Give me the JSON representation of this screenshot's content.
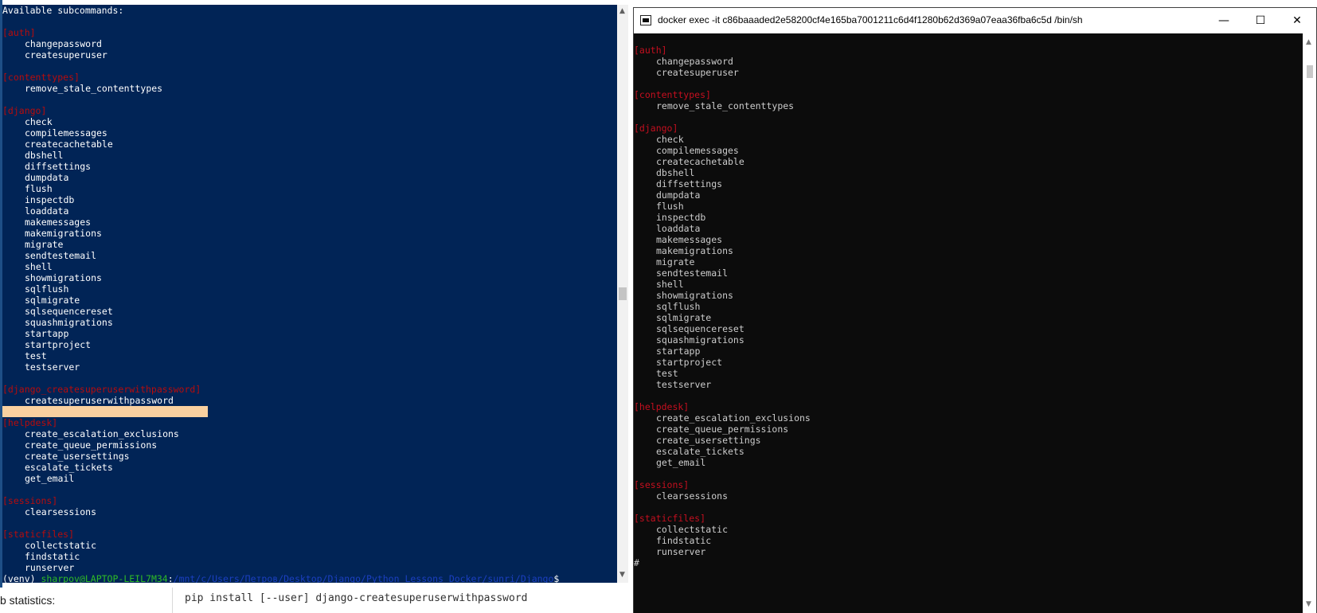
{
  "left_terminal": {
    "lines": [
      {
        "text": "Available subcommands:",
        "kind": "plain"
      },
      {
        "text": "",
        "kind": "plain"
      },
      {
        "text": "[auth]",
        "kind": "head"
      },
      {
        "text": "changepassword",
        "kind": "sub"
      },
      {
        "text": "createsuperuser",
        "kind": "sub"
      },
      {
        "text": "",
        "kind": "plain"
      },
      {
        "text": "[contenttypes]",
        "kind": "head"
      },
      {
        "text": "remove_stale_contenttypes",
        "kind": "sub"
      },
      {
        "text": "",
        "kind": "plain"
      },
      {
        "text": "[django]",
        "kind": "head"
      },
      {
        "text": "check",
        "kind": "sub"
      },
      {
        "text": "compilemessages",
        "kind": "sub"
      },
      {
        "text": "createcachetable",
        "kind": "sub"
      },
      {
        "text": "dbshell",
        "kind": "sub"
      },
      {
        "text": "diffsettings",
        "kind": "sub"
      },
      {
        "text": "dumpdata",
        "kind": "sub"
      },
      {
        "text": "flush",
        "kind": "sub"
      },
      {
        "text": "inspectdb",
        "kind": "sub"
      },
      {
        "text": "loaddata",
        "kind": "sub"
      },
      {
        "text": "makemessages",
        "kind": "sub"
      },
      {
        "text": "makemigrations",
        "kind": "sub"
      },
      {
        "text": "migrate",
        "kind": "sub"
      },
      {
        "text": "sendtestemail",
        "kind": "sub"
      },
      {
        "text": "shell",
        "kind": "sub"
      },
      {
        "text": "showmigrations",
        "kind": "sub"
      },
      {
        "text": "sqlflush",
        "kind": "sub"
      },
      {
        "text": "sqlmigrate",
        "kind": "sub"
      },
      {
        "text": "sqlsequencereset",
        "kind": "sub"
      },
      {
        "text": "squashmigrations",
        "kind": "sub"
      },
      {
        "text": "startapp",
        "kind": "sub"
      },
      {
        "text": "startproject",
        "kind": "sub"
      },
      {
        "text": "test",
        "kind": "sub"
      },
      {
        "text": "testserver",
        "kind": "sub"
      },
      {
        "text": "",
        "kind": "plain"
      },
      {
        "text": "[django_createsuperuserwithpassword]",
        "kind": "head"
      },
      {
        "text": "createsuperuserwithpassword",
        "kind": "sub"
      },
      {
        "text": "",
        "kind": "sel"
      },
      {
        "text": "[helpdesk]",
        "kind": "head"
      },
      {
        "text": "create_escalation_exclusions",
        "kind": "sub"
      },
      {
        "text": "create_queue_permissions",
        "kind": "sub"
      },
      {
        "text": "create_usersettings",
        "kind": "sub"
      },
      {
        "text": "escalate_tickets",
        "kind": "sub"
      },
      {
        "text": "get_email",
        "kind": "sub"
      },
      {
        "text": "",
        "kind": "plain"
      },
      {
        "text": "[sessions]",
        "kind": "head"
      },
      {
        "text": "clearsessions",
        "kind": "sub"
      },
      {
        "text": "",
        "kind": "plain"
      },
      {
        "text": "[staticfiles]",
        "kind": "head"
      },
      {
        "text": "collectstatic",
        "kind": "sub"
      },
      {
        "text": "findstatic",
        "kind": "sub"
      },
      {
        "text": "runserver",
        "kind": "sub"
      }
    ],
    "prompt": {
      "venv": "(venv) ",
      "user": "sharpov@LAPTOP-LEIL7M34",
      "sep": ":",
      "path": "/mnt/c/Users/Петров/Desktop/Django/Python_Lessons_Docker/sunri/Django",
      "end": "$"
    }
  },
  "bottom_strip": {
    "left_label": "b statistics:",
    "code": "pip install [--user] django-createsuperuserwithpassword"
  },
  "docker_window": {
    "title": "docker  exec -it c86baaaded2e58200cf4e165ba7001211c6d4f1280b62d369a07eaa36fba6c5d /bin/sh",
    "buttons": {
      "minimize": "—",
      "maximize": "☐",
      "close": "✕"
    },
    "lines": [
      {
        "text": "[auth]",
        "kind": "head"
      },
      {
        "text": "changepassword",
        "kind": "sub"
      },
      {
        "text": "createsuperuser",
        "kind": "sub"
      },
      {
        "text": "",
        "kind": "plain"
      },
      {
        "text": "[contenttypes]",
        "kind": "head"
      },
      {
        "text": "remove_stale_contenttypes",
        "kind": "sub"
      },
      {
        "text": "",
        "kind": "plain"
      },
      {
        "text": "[django]",
        "kind": "head"
      },
      {
        "text": "check",
        "kind": "sub"
      },
      {
        "text": "compilemessages",
        "kind": "sub"
      },
      {
        "text": "createcachetable",
        "kind": "sub"
      },
      {
        "text": "dbshell",
        "kind": "sub"
      },
      {
        "text": "diffsettings",
        "kind": "sub"
      },
      {
        "text": "dumpdata",
        "kind": "sub"
      },
      {
        "text": "flush",
        "kind": "sub"
      },
      {
        "text": "inspectdb",
        "kind": "sub"
      },
      {
        "text": "loaddata",
        "kind": "sub"
      },
      {
        "text": "makemessages",
        "kind": "sub"
      },
      {
        "text": "makemigrations",
        "kind": "sub"
      },
      {
        "text": "migrate",
        "kind": "sub"
      },
      {
        "text": "sendtestemail",
        "kind": "sub"
      },
      {
        "text": "shell",
        "kind": "sub"
      },
      {
        "text": "showmigrations",
        "kind": "sub"
      },
      {
        "text": "sqlflush",
        "kind": "sub"
      },
      {
        "text": "sqlmigrate",
        "kind": "sub"
      },
      {
        "text": "sqlsequencereset",
        "kind": "sub"
      },
      {
        "text": "squashmigrations",
        "kind": "sub"
      },
      {
        "text": "startapp",
        "kind": "sub"
      },
      {
        "text": "startproject",
        "kind": "sub"
      },
      {
        "text": "test",
        "kind": "sub"
      },
      {
        "text": "testserver",
        "kind": "sub"
      },
      {
        "text": "",
        "kind": "plain"
      },
      {
        "text": "[helpdesk]",
        "kind": "head"
      },
      {
        "text": "create_escalation_exclusions",
        "kind": "sub"
      },
      {
        "text": "create_queue_permissions",
        "kind": "sub"
      },
      {
        "text": "create_usersettings",
        "kind": "sub"
      },
      {
        "text": "escalate_tickets",
        "kind": "sub"
      },
      {
        "text": "get_email",
        "kind": "sub"
      },
      {
        "text": "",
        "kind": "plain"
      },
      {
        "text": "[sessions]",
        "kind": "head"
      },
      {
        "text": "clearsessions",
        "kind": "sub"
      },
      {
        "text": "",
        "kind": "plain"
      },
      {
        "text": "[staticfiles]",
        "kind": "head"
      },
      {
        "text": "collectstatic",
        "kind": "sub"
      },
      {
        "text": "findstatic",
        "kind": "sub"
      },
      {
        "text": "runserver",
        "kind": "sub"
      },
      {
        "text": "#",
        "kind": "plain"
      }
    ]
  },
  "colors": {
    "left_bg": "#012456",
    "right_bg": "#0c0c0c",
    "section_red": "#c50f1f",
    "prompt_green": "#2fbc25",
    "prompt_path_blue": "#1b3fc0",
    "selection": "#f9d0a0"
  }
}
